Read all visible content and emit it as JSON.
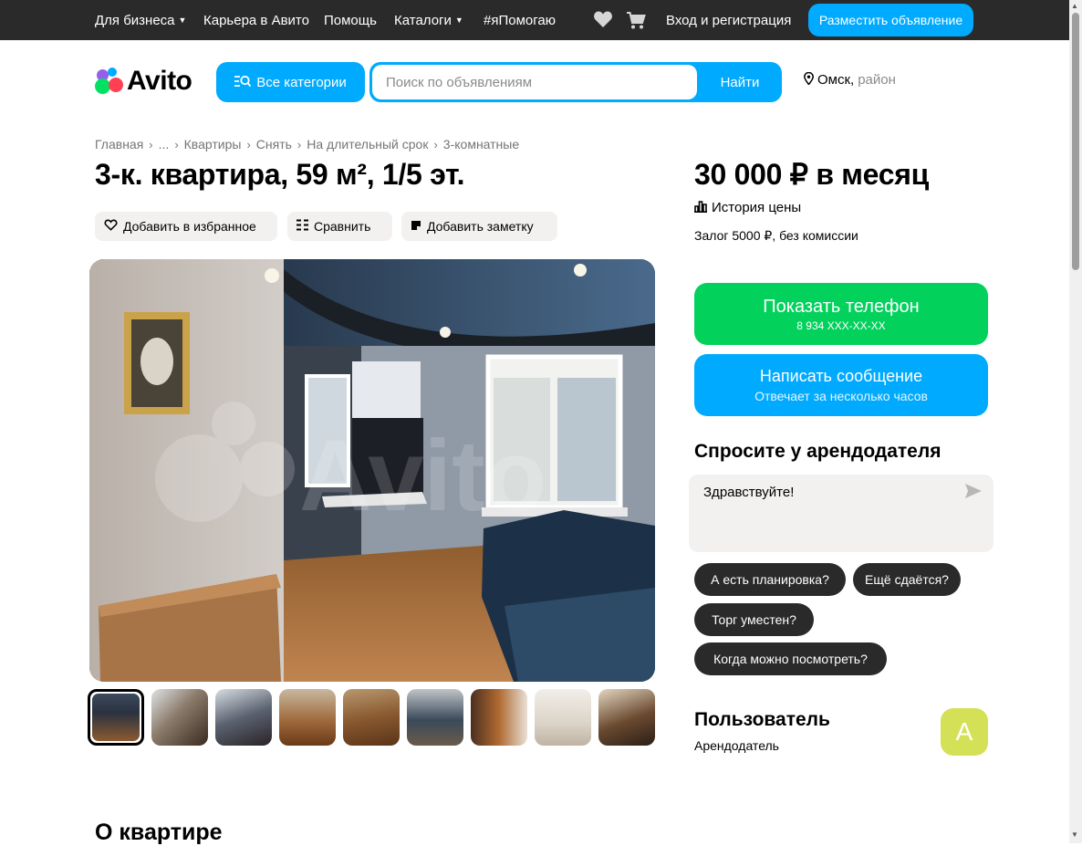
{
  "topbar": {
    "business": "Для бизнеса",
    "career": "Карьера в Авито",
    "help": "Помощь",
    "catalogs": "Каталоги",
    "help_hashtag": "#яПомогаю",
    "login": "Вход и регистрация",
    "post_ad": "Разместить объявление",
    "icons": [
      "heart-icon",
      "cart-icon"
    ]
  },
  "header": {
    "logo": "Avito",
    "categories_button": "Все категории",
    "search_placeholder": "Поиск по объявлениям",
    "search_value": "",
    "find_button": "Найти",
    "city": "Омск,",
    "district": "район"
  },
  "breadcrumbs": [
    "Главная",
    "...",
    "Квартиры",
    "Снять",
    "На длительный срок",
    "3-комнатные"
  ],
  "listing": {
    "title": "3-к. квартира, 59 м², 1/5 эт.",
    "actions": {
      "favorite": "Добавить в избранное",
      "compare": "Сравнить",
      "note": "Добавить заметку"
    },
    "photos_count": 9,
    "active_photo": 1,
    "watermark": "Avito"
  },
  "sidebar": {
    "price": "30 000 ₽ в месяц",
    "price_history": "История цены",
    "deposit": "Залог 5000 ₽, без комиссии",
    "phone_button": "Показать телефон",
    "phone_masked": "8 934 XXX-XX-XX",
    "message_button": "Написать сообщение",
    "message_sub": "Отвечает за несколько часов",
    "ask_title": "Спросите у арендодателя",
    "ask_text": "Здравствуйте!",
    "quick_questions": [
      "А есть планировка?",
      "Ещё сдаётся?",
      "Торг уместен?",
      "Когда можно посмотреть?"
    ],
    "seller_name": "Пользователь",
    "seller_role": "Арендодатель",
    "avatar_letter": "A"
  },
  "section": {
    "about": "О квартире"
  },
  "colors": {
    "accent_blue": "#00aaff",
    "phone_green": "#02d15c",
    "topbar": "#2a2a2a",
    "chip": "#2a2a2a",
    "avatar": "#d4e157"
  }
}
